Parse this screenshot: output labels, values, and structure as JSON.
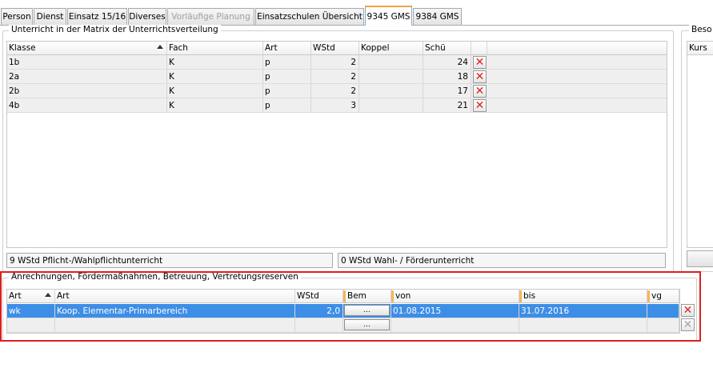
{
  "tabs": [
    {
      "label": "Person"
    },
    {
      "label": "Dienst"
    },
    {
      "label": "Einsatz 15/16"
    },
    {
      "label": "Diverses"
    },
    {
      "label": "Vorläufige Planung"
    },
    {
      "label": "Einsatzschulen Übersicht"
    },
    {
      "label": "9345 GMS"
    },
    {
      "label": "9384 GMS"
    }
  ],
  "active_tab": "9345 GMS",
  "disabled_tab": "Vorläufige Planung",
  "matrix": {
    "title": "Unterricht in der Matrix der Unterrichtsverteilung",
    "columns": [
      "Klasse",
      "Fach",
      "Art",
      "WStd",
      "Koppel",
      "Schü"
    ],
    "sorted_column": "Klasse",
    "rows": [
      {
        "klasse": "1b",
        "fach": "K",
        "art": "p",
        "wstd": "2",
        "koppel": "",
        "schue": "24"
      },
      {
        "klasse": "2a",
        "fach": "K",
        "art": "p",
        "wstd": "2",
        "koppel": "",
        "schue": "18"
      },
      {
        "klasse": "2b",
        "fach": "K",
        "art": "p",
        "wstd": "2",
        "koppel": "",
        "schue": "17"
      },
      {
        "klasse": "4b",
        "fach": "K",
        "art": "p",
        "wstd": "3",
        "koppel": "",
        "schue": "21"
      }
    ],
    "delete_icon": "red-x-icon",
    "summary_left": "9 WStd Pflicht-/Wahlpflichtunterricht",
    "summary_right": "0 WStd Wahl- / Förderunterricht"
  },
  "side_panel": {
    "title": "Beso",
    "column": "Kurs"
  },
  "anrechnungen": {
    "title": "Anrechnungen, Fördermaßnahmen, Betreuung, Vertretungsreserven",
    "columns": [
      "Art",
      "Art",
      "WStd",
      "Bem",
      "von",
      "bis",
      "vg"
    ],
    "sorted_column": "Art",
    "rows": [
      {
        "art_code": "wk",
        "art": "Koop. Elementar-Primarbereich",
        "wstd": "2,0",
        "bem_button": "...",
        "von": "01.08.2015",
        "bis": "31.07.2016",
        "vg": "",
        "selected": true
      },
      {
        "art_code": "",
        "art": "",
        "wstd": "",
        "bem_button": "...",
        "von": "",
        "bis": "",
        "vg": "",
        "selected": false
      }
    ]
  },
  "colors": {
    "selection": "#3d8ee6",
    "highlight_frame": "#dd1f1f",
    "active_tab_accent": "#f2a33a",
    "delete_red": "#e0201f"
  }
}
